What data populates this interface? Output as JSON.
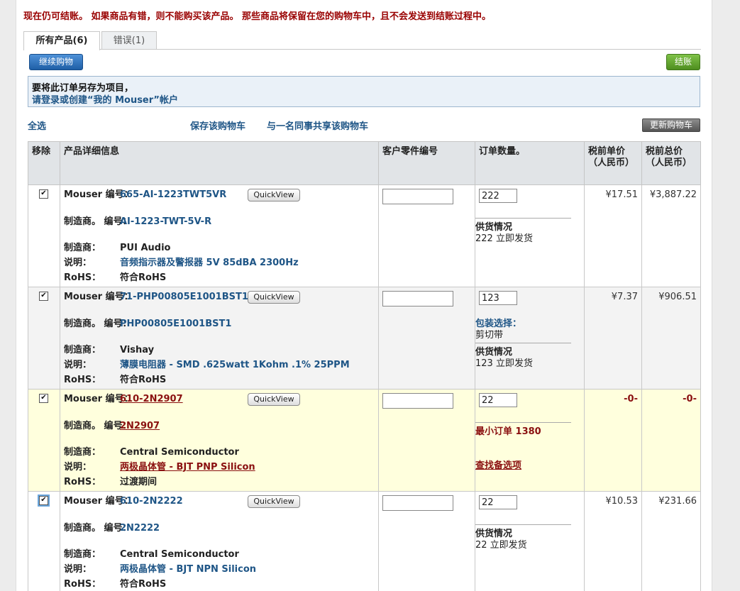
{
  "warning": "现在仍可结账。 如果商品有错，则不能购买该产品。 那些商品将保留在您的购物车中，且不会发送到结账过程中。",
  "tabs": {
    "all": "所有产品(6)",
    "errors": "错误(1)"
  },
  "buttons": {
    "continue": "继续购物",
    "checkout": "结账",
    "update": "更新购物车"
  },
  "notice": {
    "line1": "要将此订单另存为项目，",
    "line2": "请登录或创建“我的 Mouser”帐户"
  },
  "links": {
    "select_all": "全选",
    "save_cart": "保存该购物车",
    "share_cart": "与一名同事共享该购物车"
  },
  "headers": {
    "remove": "移除",
    "details": "产品详细信息",
    "customer_pn": "客户零件编号",
    "qty": "订单数量。",
    "unit_price": "税前单价（人民币）",
    "total_price": "税前总价（人民币）"
  },
  "labels": {
    "mouser_no": "Mouser 编号：",
    "mfr_no": "制造商。 编号：",
    "mfr": "制造商：",
    "desc": "说明：",
    "rohs": "RoHS：",
    "quickview": "QuickView"
  },
  "rows": [
    {
      "mouser_no": "665-AI-1223TWT5VR",
      "mfr_no": "AI-1223-TWT-5V-R",
      "mfr": "PUI Audio",
      "desc": "音频指示器及警报器 5V 85dBA 2300Hz",
      "rohs": "符合RoHS",
      "qty": "222",
      "avail_title": "供货情况",
      "avail": "222 立即发货",
      "unit": "¥17.51",
      "total": "¥3,887.22"
    },
    {
      "mouser_no": "71-PHP00805E1001BST1",
      "mfr_no": "PHP00805E1001BST1",
      "mfr": "Vishay",
      "desc": "薄膜电阻器 - SMD .625watt 1Kohm .1% 25PPM",
      "rohs": "符合RoHS",
      "qty": "123",
      "pack_title": "包装选择：",
      "pack": "剪切带",
      "avail_title": "供货情况",
      "avail": "123 立即发货",
      "unit": "¥7.37",
      "total": "¥906.51"
    },
    {
      "mouser_no": "610-2N2907",
      "mfr_no": "2N2907",
      "mfr": "Central Semiconductor",
      "desc": "两极晶体管 - BJT PNP Silicon",
      "rohs": "过渡期间",
      "qty": "22",
      "min_order": "最小订单 1380",
      "find_alt": "查找备选项",
      "unit": "-0-",
      "total": "-0-"
    },
    {
      "mouser_no": "610-2N2222",
      "mfr_no": "2N2222",
      "mfr": "Central Semiconductor",
      "desc": "两极晶体管 - BJT NPN Silicon",
      "rohs": "符合RoHS",
      "qty": "22",
      "avail_title": "供货情况",
      "avail": "22 立即发货",
      "unit": "¥10.53",
      "total": "¥231.66"
    }
  ]
}
